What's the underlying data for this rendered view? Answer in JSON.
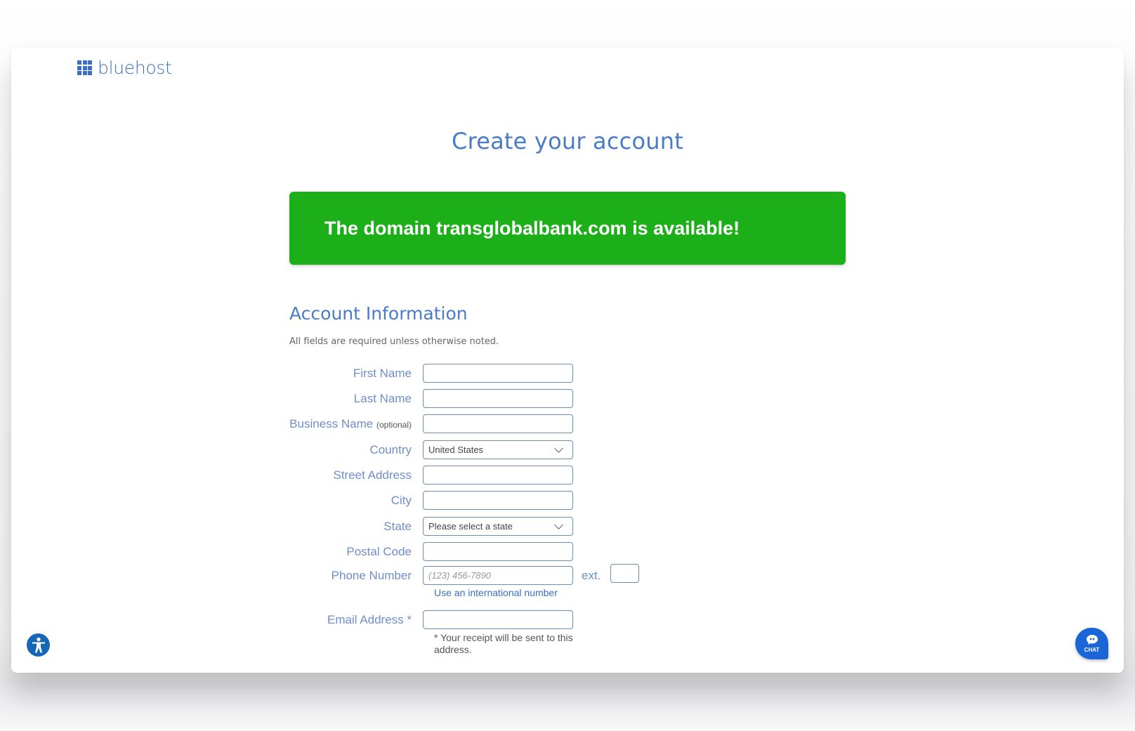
{
  "brand": {
    "name": "bluehost",
    "color": "#3a6fc4"
  },
  "page": {
    "title": "Create your account"
  },
  "banner": {
    "text": "The domain transglobalbank.com is available!",
    "color": "#1daf1a"
  },
  "account": {
    "heading": "Account Information",
    "note": "All fields are required unless otherwise noted.",
    "fields": {
      "first_name": {
        "label": "First Name",
        "value": ""
      },
      "last_name": {
        "label": "Last Name",
        "value": ""
      },
      "business_name": {
        "label": "Business Name",
        "suffix": "(optional)",
        "value": ""
      },
      "country": {
        "label": "Country",
        "value": "United States"
      },
      "street": {
        "label": "Street Address",
        "value": ""
      },
      "city": {
        "label": "City",
        "value": ""
      },
      "state": {
        "label": "State",
        "value": "Please select a state"
      },
      "postal": {
        "label": "Postal Code",
        "value": ""
      },
      "phone": {
        "label": "Phone Number",
        "placeholder": "(123) 456-7890",
        "value": "",
        "ext_label": "ext.",
        "ext_value": ""
      },
      "intl_link": "Use an international number",
      "email": {
        "label": "Email Address *",
        "value": "",
        "note": "* Your receipt will be sent to this address."
      }
    }
  },
  "widgets": {
    "accessibility_icon": "accessibility-icon",
    "chat": {
      "label": "CHAT",
      "icon": "chat-bubble-icon"
    }
  }
}
